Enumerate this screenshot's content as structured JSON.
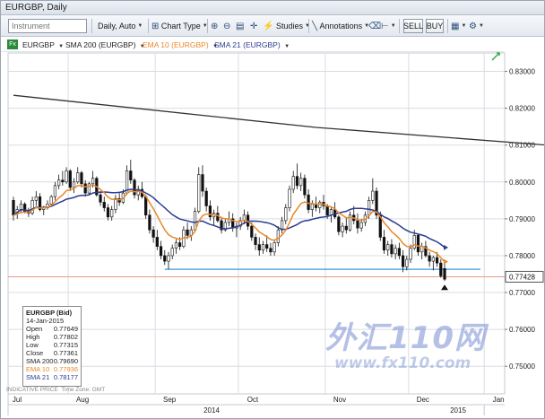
{
  "window": {
    "title": "EURGBP, Daily"
  },
  "toolbar": {
    "instrument_placeholder": "Instrument",
    "period_label": "Daily, Auto",
    "chart_type_label": "Chart Type",
    "studies_label": "Studies",
    "annotations_label": "Annotations",
    "sell_label": "SELL",
    "buy_label": "BUY"
  },
  "legend": {
    "symbol": "EURGBP",
    "sma200": "SMA 200 (EURGBP)",
    "ema10": "EMA 10 (EURGBP)",
    "sma21": "SMA 21 (EURGBP)"
  },
  "colors": {
    "candle_up": "#ffffff",
    "candle_down": "#111111",
    "sma200": "#333333",
    "ema10": "#e8892a",
    "sma21": "#2c3c8f",
    "support_line": "#3a9bd8",
    "price_line": "#e89a8a",
    "grid": "#d8dde3"
  },
  "infobox": {
    "title": "EURGBP (Bid)",
    "date": "14-Jan-2015",
    "rows": [
      {
        "label": "Open",
        "value": "0.77649",
        "color": "#222222"
      },
      {
        "label": "High",
        "value": "0.77802",
        "color": "#222222"
      },
      {
        "label": "Low",
        "value": "0.77315",
        "color": "#222222"
      },
      {
        "label": "Close",
        "value": "0.77361",
        "color": "#222222"
      },
      {
        "label": "SMA 200",
        "value": "0.79690",
        "color": "#222222"
      },
      {
        "label": "EMA 10",
        "value": "0.77936",
        "color": "#e8892a"
      },
      {
        "label": "SMA 21",
        "value": "0.78177",
        "color": "#2c3c8f"
      }
    ]
  },
  "footer": {
    "indicative": "INDICATIVE PRICE",
    "timezone": "Time Zone: GMT"
  },
  "watermark": {
    "title": "外汇110网",
    "url": "www.fx110.com"
  },
  "chart_data": {
    "type": "candlestick",
    "ylim": [
      0.7425,
      0.835
    ],
    "y_ticks": [
      "0.83000",
      "0.82000",
      "0.81000",
      "0.80000",
      "0.79000",
      "0.78000",
      "0.77000",
      "0.76000",
      "0.75000"
    ],
    "current_price": "0.77428",
    "x_months": [
      "Jul",
      "Aug",
      "Sep",
      "Oct",
      "Nov",
      "Dec",
      "Jan"
    ],
    "x_years": [
      "2014",
      "2015"
    ],
    "support_level": 0.7763,
    "sma200": [
      [
        0,
        0.8235
      ],
      [
        80,
        0.8148
      ],
      [
        160,
        0.8085
      ],
      [
        250,
        0.804
      ],
      [
        350,
        0.801
      ],
      [
        430,
        0.8
      ],
      [
        495,
        0.7962
      ]
    ],
    "candles": [
      [
        0.795,
        0.796,
        0.7895,
        0.791
      ],
      [
        0.7915,
        0.7935,
        0.79,
        0.7925
      ],
      [
        0.7925,
        0.795,
        0.7915,
        0.794
      ],
      [
        0.794,
        0.7945,
        0.7915,
        0.792
      ],
      [
        0.792,
        0.793,
        0.7905,
        0.7915
      ],
      [
        0.7915,
        0.796,
        0.791,
        0.795
      ],
      [
        0.795,
        0.7975,
        0.7935,
        0.796
      ],
      [
        0.796,
        0.797,
        0.792,
        0.7925
      ],
      [
        0.7925,
        0.7935,
        0.791,
        0.793
      ],
      [
        0.793,
        0.795,
        0.7925,
        0.794
      ],
      [
        0.794,
        0.7965,
        0.7935,
        0.796
      ],
      [
        0.796,
        0.8,
        0.795,
        0.799
      ],
      [
        0.799,
        0.802,
        0.798,
        0.8005
      ],
      [
        0.8005,
        0.803,
        0.799,
        0.8
      ],
      [
        0.8,
        0.804,
        0.7995,
        0.803
      ],
      [
        0.803,
        0.8035,
        0.7975,
        0.7985
      ],
      [
        0.7985,
        0.801,
        0.797,
        0.8
      ],
      [
        0.8,
        0.804,
        0.7995,
        0.8025
      ],
      [
        0.8025,
        0.803,
        0.7985,
        0.7995
      ],
      [
        0.7995,
        0.8005,
        0.796,
        0.797
      ],
      [
        0.797,
        0.8,
        0.7965,
        0.7995
      ],
      [
        0.7995,
        0.803,
        0.7985,
        0.801
      ],
      [
        0.801,
        0.8015,
        0.796,
        0.7965
      ],
      [
        0.7965,
        0.7975,
        0.7935,
        0.7945
      ],
      [
        0.7945,
        0.796,
        0.792,
        0.793
      ],
      [
        0.793,
        0.794,
        0.7895,
        0.7905
      ],
      [
        0.7905,
        0.7935,
        0.7895,
        0.7925
      ],
      [
        0.7925,
        0.7965,
        0.7915,
        0.7955
      ],
      [
        0.7955,
        0.797,
        0.7935,
        0.7945
      ],
      [
        0.7945,
        0.798,
        0.794,
        0.797
      ],
      [
        0.797,
        0.8045,
        0.7965,
        0.803
      ],
      [
        0.803,
        0.806,
        0.7995,
        0.8005
      ],
      [
        0.8005,
        0.801,
        0.7955,
        0.7965
      ],
      [
        0.7965,
        0.799,
        0.795,
        0.798
      ],
      [
        0.798,
        0.8,
        0.7955,
        0.796
      ],
      [
        0.796,
        0.7965,
        0.79,
        0.791
      ],
      [
        0.791,
        0.7925,
        0.786,
        0.787
      ],
      [
        0.787,
        0.788,
        0.7835,
        0.785
      ],
      [
        0.785,
        0.787,
        0.7815,
        0.7825
      ],
      [
        0.7825,
        0.784,
        0.779,
        0.78
      ],
      [
        0.78,
        0.7815,
        0.7775,
        0.7785
      ],
      [
        0.7785,
        0.781,
        0.7763,
        0.78
      ],
      [
        0.78,
        0.783,
        0.779,
        0.782
      ],
      [
        0.782,
        0.7845,
        0.7805,
        0.7835
      ],
      [
        0.7835,
        0.785,
        0.7815,
        0.7825
      ],
      [
        0.7825,
        0.788,
        0.782,
        0.787
      ],
      [
        0.787,
        0.789,
        0.7845,
        0.7855
      ],
      [
        0.7855,
        0.788,
        0.784,
        0.787
      ],
      [
        0.787,
        0.793,
        0.7865,
        0.792
      ],
      [
        0.792,
        0.804,
        0.7915,
        0.802
      ],
      [
        0.802,
        0.8045,
        0.796,
        0.7975
      ],
      [
        0.7975,
        0.7985,
        0.792,
        0.7935
      ],
      [
        0.7935,
        0.795,
        0.7895,
        0.7905
      ],
      [
        0.7905,
        0.7925,
        0.788,
        0.7915
      ],
      [
        0.7915,
        0.7935,
        0.789,
        0.7895
      ],
      [
        0.7895,
        0.7905,
        0.786,
        0.787
      ],
      [
        0.787,
        0.79,
        0.7865,
        0.789
      ],
      [
        0.789,
        0.792,
        0.788,
        0.79
      ],
      [
        0.79,
        0.7915,
        0.7865,
        0.7875
      ],
      [
        0.7875,
        0.789,
        0.785,
        0.788
      ],
      [
        0.788,
        0.7905,
        0.787,
        0.7895
      ],
      [
        0.7895,
        0.7925,
        0.7885,
        0.791
      ],
      [
        0.791,
        0.792,
        0.787,
        0.788
      ],
      [
        0.788,
        0.789,
        0.784,
        0.785
      ],
      [
        0.785,
        0.786,
        0.7815,
        0.783
      ],
      [
        0.783,
        0.785,
        0.78,
        0.7815
      ],
      [
        0.7815,
        0.784,
        0.7805,
        0.783
      ],
      [
        0.783,
        0.7855,
        0.781,
        0.782
      ],
      [
        0.782,
        0.7835,
        0.78,
        0.781
      ],
      [
        0.781,
        0.784,
        0.78,
        0.7835
      ],
      [
        0.7835,
        0.788,
        0.7825,
        0.787
      ],
      [
        0.787,
        0.7905,
        0.786,
        0.7895
      ],
      [
        0.7895,
        0.794,
        0.7885,
        0.793
      ],
      [
        0.793,
        0.799,
        0.792,
        0.798
      ],
      [
        0.798,
        0.803,
        0.797,
        0.8015
      ],
      [
        0.8015,
        0.805,
        0.798,
        0.799
      ],
      [
        0.799,
        0.8025,
        0.7975,
        0.801
      ],
      [
        0.801,
        0.802,
        0.7955,
        0.7965
      ],
      [
        0.7965,
        0.798,
        0.7915,
        0.7925
      ],
      [
        0.7925,
        0.795,
        0.7905,
        0.794
      ],
      [
        0.794,
        0.796,
        0.792,
        0.793
      ],
      [
        0.793,
        0.795,
        0.7915,
        0.7945
      ],
      [
        0.7945,
        0.7965,
        0.7925,
        0.7935
      ],
      [
        0.7935,
        0.794,
        0.79,
        0.791
      ],
      [
        0.791,
        0.793,
        0.789,
        0.7925
      ],
      [
        0.7925,
        0.7945,
        0.79,
        0.7905
      ],
      [
        0.7905,
        0.791,
        0.7855,
        0.7865
      ],
      [
        0.7865,
        0.789,
        0.785,
        0.788
      ],
      [
        0.788,
        0.7905,
        0.786,
        0.787
      ],
      [
        0.787,
        0.792,
        0.7865,
        0.791
      ],
      [
        0.791,
        0.7935,
        0.7885,
        0.7895
      ],
      [
        0.7895,
        0.7915,
        0.786,
        0.7875
      ],
      [
        0.7875,
        0.79,
        0.7865,
        0.789
      ],
      [
        0.789,
        0.792,
        0.788,
        0.791
      ],
      [
        0.791,
        0.796,
        0.79,
        0.795
      ],
      [
        0.795,
        0.801,
        0.794,
        0.7975
      ],
      [
        0.7975,
        0.7985,
        0.79,
        0.791
      ],
      [
        0.791,
        0.792,
        0.784,
        0.785
      ],
      [
        0.785,
        0.787,
        0.7805,
        0.7815
      ],
      [
        0.7815,
        0.784,
        0.78,
        0.783
      ],
      [
        0.783,
        0.7845,
        0.7795,
        0.7805
      ],
      [
        0.7805,
        0.783,
        0.779,
        0.782
      ],
      [
        0.782,
        0.7835,
        0.779,
        0.78
      ],
      [
        0.78,
        0.7815,
        0.7755,
        0.777
      ],
      [
        0.777,
        0.78,
        0.776,
        0.779
      ],
      [
        0.779,
        0.783,
        0.778,
        0.782
      ],
      [
        0.782,
        0.787,
        0.7815,
        0.7855
      ],
      [
        0.7855,
        0.786,
        0.78,
        0.781
      ],
      [
        0.781,
        0.7835,
        0.779,
        0.7825
      ],
      [
        0.7825,
        0.784,
        0.7795,
        0.78
      ],
      [
        0.78,
        0.781,
        0.777,
        0.7785
      ],
      [
        0.7785,
        0.78,
        0.776,
        0.7795
      ],
      [
        0.7795,
        0.781,
        0.777,
        0.778
      ],
      [
        0.778,
        0.779,
        0.774,
        0.7745
      ],
      [
        0.7765,
        0.778,
        0.7731,
        0.7736
      ]
    ]
  }
}
